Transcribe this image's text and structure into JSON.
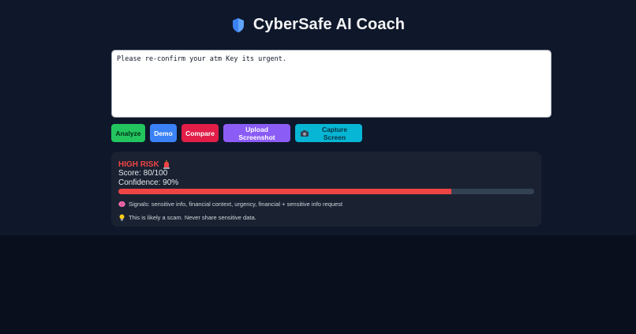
{
  "header": {
    "title": "CyberSafe AI Coach",
    "icon": "shield-icon"
  },
  "message_input": {
    "value": "Please re-confirm your atm Key its urgent.",
    "placeholder": ""
  },
  "buttons": {
    "analyze": "Analyze",
    "demo": "Demo",
    "compare": "Compare",
    "upload": "Upload Screenshot",
    "capture": "Capture Screen"
  },
  "result": {
    "risk_label": "HIGH RISK",
    "score": "Score: 80/100",
    "confidence": "Confidence: 90%",
    "risk_percent": 80,
    "signals": "Signals: sensitive info, financial context, urgency, financial + sensitive info request",
    "advice": "This is likely a scam. Never share sensitive data."
  },
  "colors": {
    "accent_danger": "#ef4444",
    "analyze": "#22c55e",
    "demo": "#3b82f6",
    "compare": "#e11d48",
    "upload": "#8b5cf6",
    "capture": "#06b6d4"
  }
}
